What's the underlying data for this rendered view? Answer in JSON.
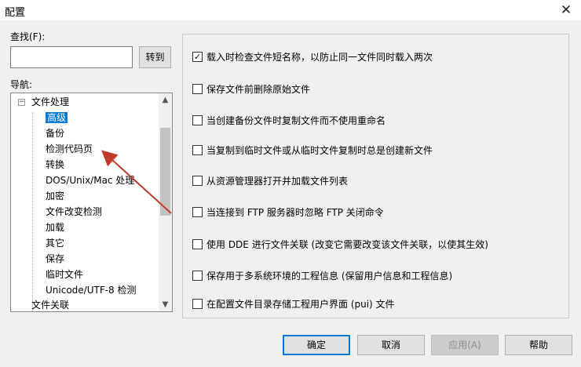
{
  "window": {
    "title": "配置",
    "close_glyph": "✕"
  },
  "find": {
    "label": "查找(F):",
    "value": "",
    "goto_label": "转到"
  },
  "nav": {
    "label": "导航:",
    "root_label": "文件处理",
    "items": [
      {
        "label": "高级",
        "selected": true
      },
      {
        "label": "备份"
      },
      {
        "label": "检测代码页"
      },
      {
        "label": "转换"
      },
      {
        "label": "DOS/Unix/Mac 处理"
      },
      {
        "label": "加密"
      },
      {
        "label": "文件改变检测"
      },
      {
        "label": "加载"
      },
      {
        "label": "其它"
      },
      {
        "label": "保存"
      },
      {
        "label": "临时文件"
      },
      {
        "label": "Unicode/UTF-8 检测"
      }
    ],
    "next_root_label": "文件关联"
  },
  "options": [
    {
      "label": "载入时检查文件短名称，以防止同一文件同时载入两次",
      "checked": true
    },
    {
      "label": "保存文件前删除原始文件",
      "checked": false
    },
    {
      "label": "当创建备份文件时复制文件而不使用重命名",
      "checked": false
    },
    {
      "label": "当复制到临时文件或从临时文件复制时总是创建新文件",
      "checked": false
    },
    {
      "label": "从资源管理器打开并加载文件列表",
      "checked": false
    },
    {
      "label": "当连接到 FTP 服务器时忽略 FTP 关闭命令",
      "checked": false
    },
    {
      "label": "使用 DDE 进行文件关联 (改变它需要改变该文件关联，以使其生效)",
      "checked": false
    },
    {
      "label": "保存用于多系统环境的工程信息 (保留用户信息和工程信息)",
      "checked": false
    },
    {
      "label": "在配置文件目录存储工程用户界面 (pui) 文件",
      "checked": false
    }
  ],
  "buttons": {
    "ok": "确定",
    "cancel": "取消",
    "apply": "应用(A)",
    "help": "帮助"
  }
}
